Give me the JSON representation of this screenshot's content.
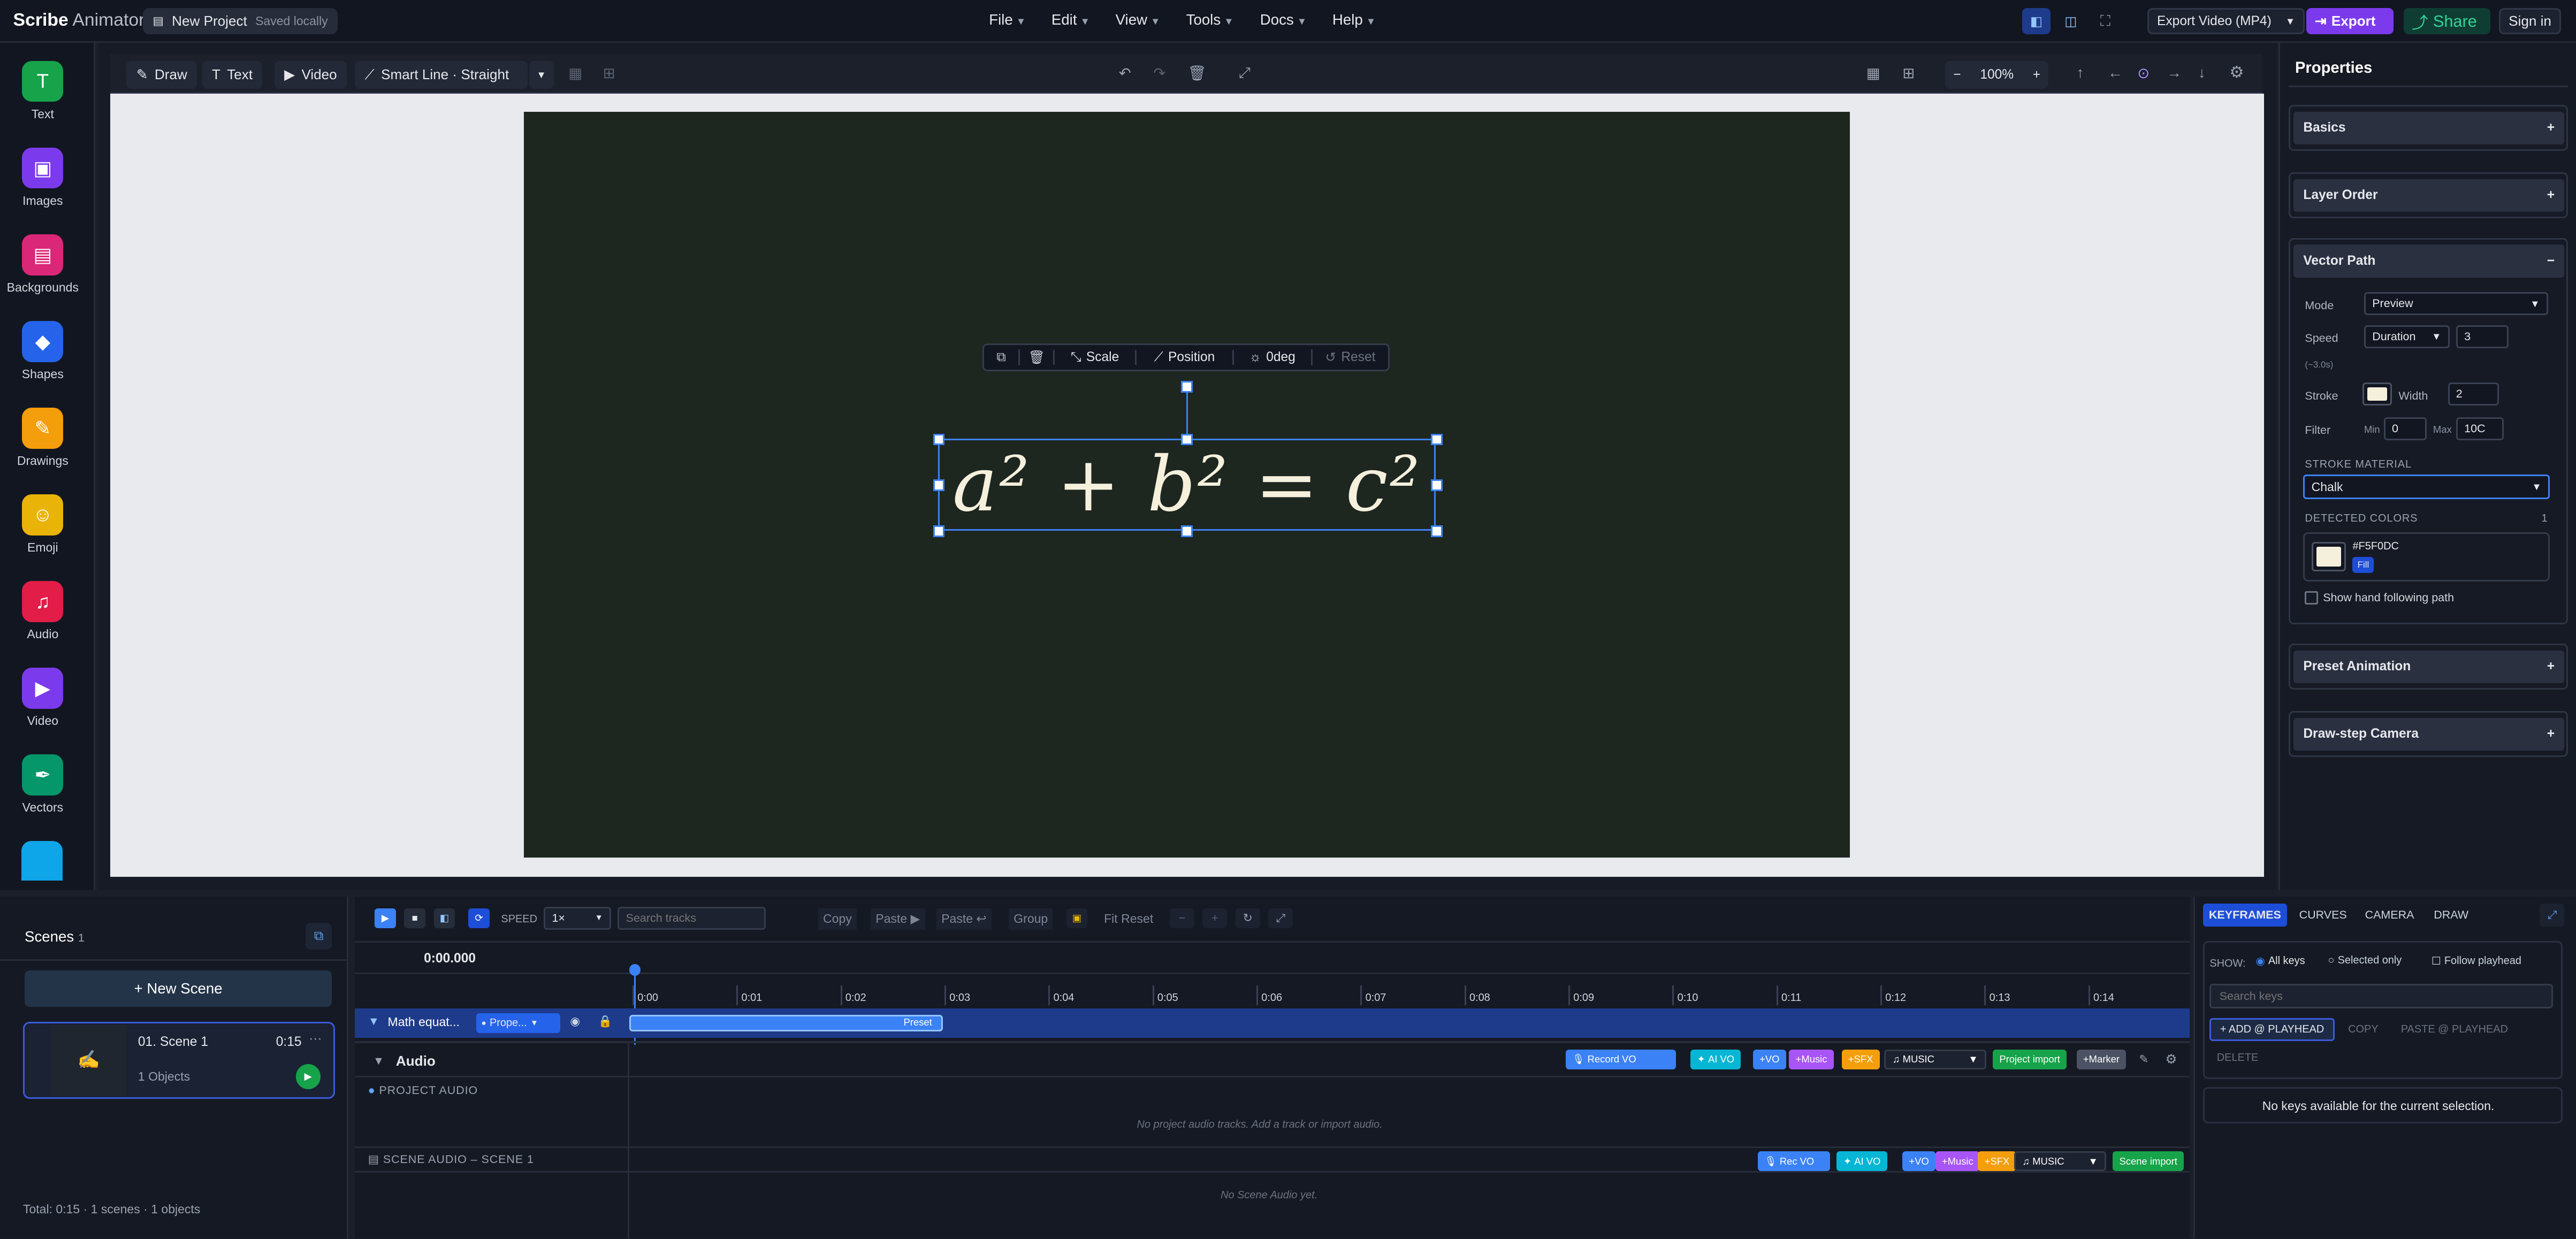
{
  "app": {
    "brand_bold": "Scribe",
    "brand_rest": "Animator",
    "project_name": "New Project",
    "save_status": "Saved locally"
  },
  "menu": [
    "File",
    "Edit",
    "View",
    "Tools",
    "Docs",
    "Help"
  ],
  "topbar": {
    "export_select": "Export Video (MP4)",
    "export_btn": "Export",
    "share_btn": "Share",
    "signin_btn": "Sign in"
  },
  "rail": [
    {
      "label": "Text",
      "icon": "text-icon",
      "color": "#16a34a"
    },
    {
      "label": "Images",
      "icon": "images-icon",
      "color": "#7c3aed"
    },
    {
      "label": "Backgrounds",
      "icon": "backgrounds-icon",
      "color": "#db2777"
    },
    {
      "label": "Shapes",
      "icon": "shapes-icon",
      "color": "#2563eb"
    },
    {
      "label": "Drawings",
      "icon": "drawings-icon",
      "color": "#f59e0b"
    },
    {
      "label": "Emoji",
      "icon": "emoji-icon",
      "color": "#eab308"
    },
    {
      "label": "Audio",
      "icon": "audio-icon",
      "color": "#e11d48"
    },
    {
      "label": "Video",
      "icon": "video-icon",
      "color": "#7c3aed"
    },
    {
      "label": "Vectors",
      "icon": "vectors-icon",
      "color": "#059669"
    }
  ],
  "toolbar": {
    "draw": "Draw",
    "text": "Text",
    "video": "Video",
    "line": "Smart Line · Straight",
    "zoom": "100%"
  },
  "canvas": {
    "equation": "a² + b² = c²",
    "float_scale": "Scale",
    "float_position": "Position",
    "float_rotate": "0deg",
    "float_reset": "Reset"
  },
  "props": {
    "title": "Properties",
    "basics": "Basics",
    "layer_order": "Layer Order",
    "vector_path": "Vector Path",
    "mode_label": "Mode",
    "mode_value": "Preview",
    "speed_label": "Speed",
    "speed_value": "Duration",
    "speed_num": "3",
    "speed_hint": "(~3.0s)",
    "stroke_label": "Stroke",
    "width_label": "Width",
    "width_value": "2",
    "filter_label": "Filter",
    "min_label": "Min",
    "min_value": "0",
    "max_label": "Max",
    "max_value": "10C",
    "material_label": "STROKE MATERIAL",
    "material_value": "Chalk",
    "detected_label": "DETECTED COLORS",
    "detected_count": "1",
    "color_hex": "#F5F0DC",
    "color_tag": "Fill",
    "hand_label": "Show hand following path",
    "preset_anim": "Preset Animation",
    "draw_camera": "Draw-step Camera",
    "stroke_color": "#f5f0dc"
  },
  "scenes": {
    "title": "Scenes",
    "count": "1",
    "new_btn": "+ New Scene",
    "scene_num": "01.",
    "scene_name": "Scene 1",
    "scene_dur": "0:15",
    "scene_objects": "1 Objects",
    "total": "Total: 0:15 · 1 scenes · 1 objects"
  },
  "timeline": {
    "speed_label": "SPEED",
    "speed_value": "1×",
    "search_placeholder": "Search tracks",
    "copy": "Copy",
    "paste": "Paste ▶",
    "paste2": "Paste ↩",
    "group": "Group",
    "fit_reset": "Fit Reset",
    "time": "0:00.000",
    "ticks": [
      "0:00",
      "0:01",
      "0:02",
      "0:03",
      "0:04",
      "0:05",
      "0:06",
      "0:07",
      "0:08",
      "0:09",
      "0:10",
      "0:11",
      "0:12",
      "0:13",
      "0:14"
    ],
    "track_name": "Math equat...",
    "track_prop": "Prope...",
    "clip_label": "Preset",
    "audio_label": "Audio",
    "record_vo": "Record VO",
    "ai_vo": "AI VO",
    "plus_vo": "+VO",
    "plus_music": "+Music",
    "plus_sfx": "+SFX",
    "music_select": "MUSIC",
    "project_import": "Project import",
    "plus_marker": "+Marker",
    "project_audio": "PROJECT AUDIO",
    "project_audio_empty": "No project audio tracks. Add a track or import audio.",
    "scene_audio": "SCENE AUDIO – SCENE 1",
    "rec_vo": "Rec VO",
    "scene_import": "Scene import",
    "scene_audio_empty": "No Scene Audio yet."
  },
  "keyframes": {
    "tabs": [
      "KEYFRAMES",
      "CURVES",
      "CAMERA",
      "DRAW"
    ],
    "show_label": "SHOW:",
    "opt_all": "All keys",
    "opt_selected": "Selected only",
    "opt_follow": "Follow playhead",
    "search_placeholder": "Search keys",
    "add_btn": "+ ADD @ PLAYHEAD",
    "copy_btn": "COPY",
    "paste_btn": "PASTE @ PLAYHEAD",
    "delete_btn": "DELETE",
    "empty": "No keys available for the current selection."
  }
}
